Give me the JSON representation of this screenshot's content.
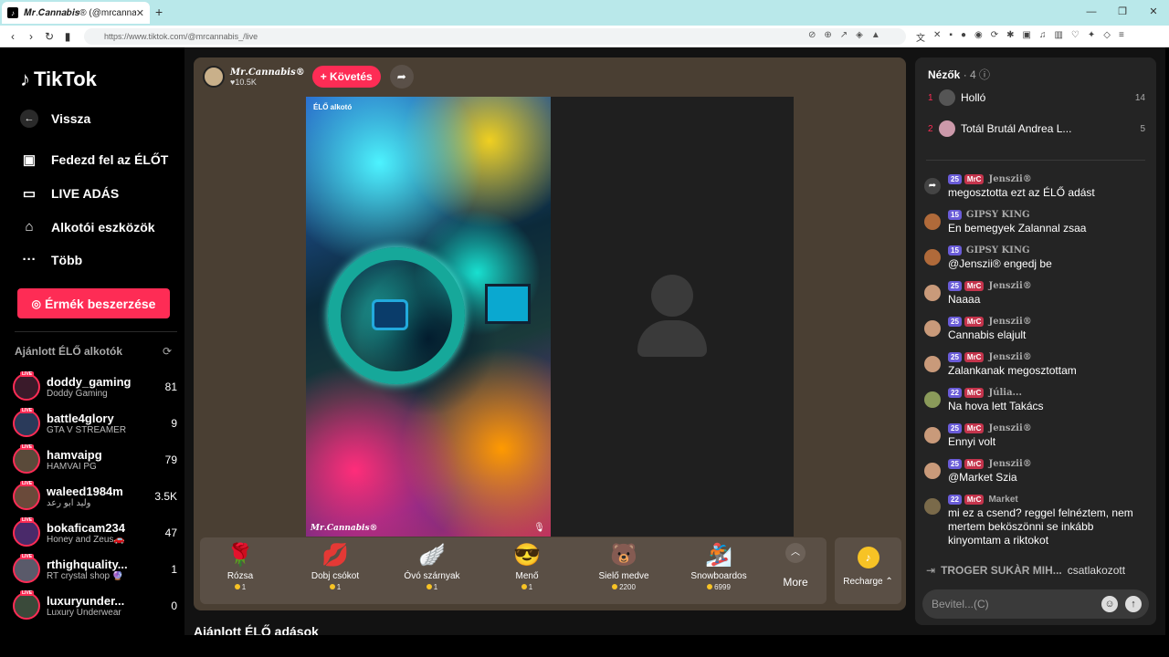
{
  "browser": {
    "tab_title": "𝑴𝒓.𝑪𝒂𝒏𝒏𝒂𝒃𝒊𝒔® (@mrcanna...",
    "url": "https://www.tiktok.com/@mrcannabis_/live"
  },
  "sidebar": {
    "logo": "TikTok",
    "back": "Vissza",
    "nav": [
      "Fedezd fel az ÉLŐT",
      "LIVE ADÁS",
      "Alkotói eszközök",
      "Több"
    ],
    "earn_button": "Érmék beszerzése",
    "recommended_title": "Ajánlott ÉLŐ alkotók",
    "creators": [
      {
        "name": "doddy_gaming",
        "sub": "Doddy Gaming",
        "count": "81"
      },
      {
        "name": "battle4glory",
        "sub": "GTA V STREAMER",
        "count": "9"
      },
      {
        "name": "hamvaipg",
        "sub": "HAMVAI PG",
        "count": "79"
      },
      {
        "name": "waleed1984m",
        "sub": "وليد ابو رعد",
        "count": "3.5K"
      },
      {
        "name": "bokaficam234",
        "sub": "Honey and Zeus🚗",
        "count": "47"
      },
      {
        "name": "rthighquality...",
        "sub": "RT crystal shop 🔮",
        "count": "1"
      },
      {
        "name": "luxuryunder...",
        "sub": "Luxury Underwear",
        "count": "0"
      }
    ],
    "live_badge": "LIVE"
  },
  "stream": {
    "host_name": "𝑴𝒓.𝑪𝒂𝒏𝒏𝒂𝒃𝒊𝒔®",
    "host_likes": "10.5K",
    "follow": "+ Követés",
    "video_label": "ÉLŐ alkotó",
    "watermark": "𝑴𝒓.𝑪𝒂𝒏𝒏𝒂𝒃𝒊𝒔®",
    "gifts": [
      {
        "icon": "🌹",
        "name": "Rózsa",
        "price": "1"
      },
      {
        "icon": "💋",
        "name": "Dobj csókot",
        "price": "1"
      },
      {
        "icon": "🪽",
        "name": "Óvó szárnyak",
        "price": "1"
      },
      {
        "icon": "😎",
        "name": "Menő",
        "price": "1"
      },
      {
        "icon": "🐻",
        "name": "Sielő medve",
        "price": "2200"
      },
      {
        "icon": "🏂",
        "name": "Snowboardos",
        "price": "6999"
      }
    ],
    "more": "More",
    "recharge": "Recharge ⌃",
    "below_title": "Ajánlott ÉLŐ adások"
  },
  "chat": {
    "viewers_label": "Nézők",
    "viewers_count": "· 4",
    "top_viewers": [
      {
        "rank": "1",
        "name": "Holló",
        "score": "14"
      },
      {
        "rank": "2",
        "name": "Totál Brutál Andrea L...",
        "score": "5"
      }
    ],
    "messages": [
      {
        "lvl": "25",
        "fan": "MrC",
        "user": "Jenszii®",
        "text": "megosztotta ezt az ÉLŐ adást"
      },
      {
        "lvl": "15",
        "fan": "",
        "user": "GIPSY KING",
        "text": "En bemegyek Zalannal zsaa"
      },
      {
        "lvl": "15",
        "fan": "",
        "user": "GIPSY KING",
        "text": "@Jenszii® engedj be"
      },
      {
        "lvl": "25",
        "fan": "MrC",
        "user": "Jenszii®",
        "text": "Naaaa"
      },
      {
        "lvl": "25",
        "fan": "MrC",
        "user": "Jenszii®",
        "text": "Cannabis elajult"
      },
      {
        "lvl": "25",
        "fan": "MrC",
        "user": "Jenszii®",
        "text": "Zalankanak megosztottam"
      },
      {
        "lvl": "22",
        "fan": "MrC",
        "user": "Júlia...",
        "text": "Na hova lett Takács"
      },
      {
        "lvl": "25",
        "fan": "MrC",
        "user": "Jenszii®",
        "text": "Ennyi volt"
      },
      {
        "lvl": "25",
        "fan": "MrC",
        "user": "Jenszii®",
        "text": "@Market Szia"
      },
      {
        "lvl": "22",
        "fan": "MrC",
        "user": "Market",
        "text": "mi ez a csend? reggel felnéztem, nem mertem beköszönni se inkább kinyomtam a riktokot"
      }
    ],
    "join_name": "TROGER SUKÀR MIH...",
    "join_text": "csatlakozott",
    "input_placeholder": "Bevitel...(C)"
  }
}
